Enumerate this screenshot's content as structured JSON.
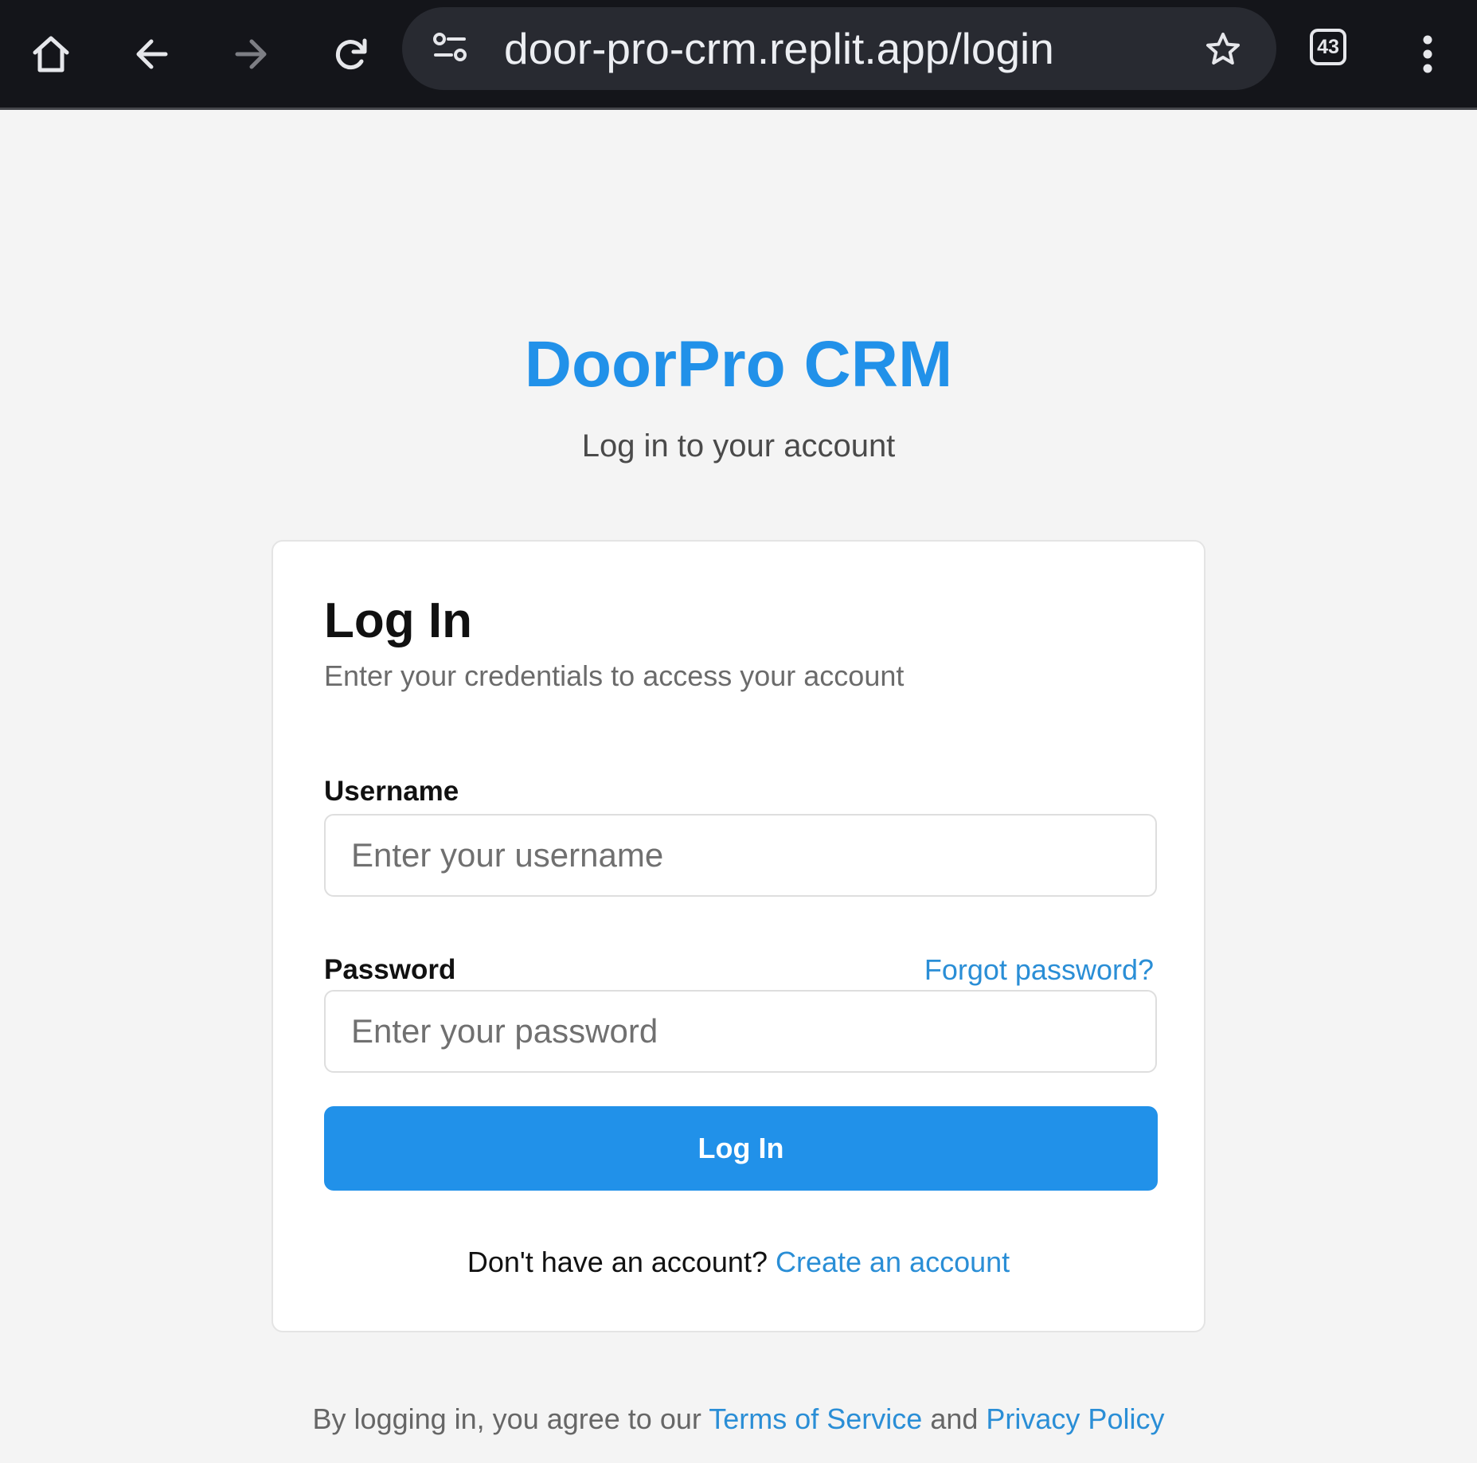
{
  "browser": {
    "url": "door-pro-crm.replit.app/login",
    "tab_count": "43",
    "icons": [
      "home-icon",
      "back-arrow-icon",
      "forward-arrow-icon",
      "reload-icon",
      "site-settings-icon",
      "bookmark-star-icon",
      "tab-switcher-icon",
      "more-menu-icon"
    ],
    "colors": {
      "toolbar": "#14151a",
      "omnibox": "#282a31"
    }
  },
  "header": {
    "brand": "DoorPro CRM",
    "subtitle": "Log in to your account"
  },
  "login_card": {
    "title": "Log In",
    "description": "Enter your credentials to access your account",
    "username": {
      "label": "Username",
      "placeholder": "Enter your username",
      "value": ""
    },
    "password": {
      "label": "Password",
      "placeholder": "Enter your password",
      "value": "",
      "forgot_link": "Forgot password?"
    },
    "submit_label": "Log In",
    "signup_prompt": "Don't have an account?",
    "signup_link": "Create an account"
  },
  "footer": {
    "prefix": "By logging in, you agree to our",
    "terms_link": "Terms of Service",
    "conjunction": "and",
    "privacy_link": "Privacy Policy"
  },
  "colors": {
    "accent": "#2191e9",
    "link": "#2a8ed6",
    "page_background": "#f4f4f4"
  }
}
